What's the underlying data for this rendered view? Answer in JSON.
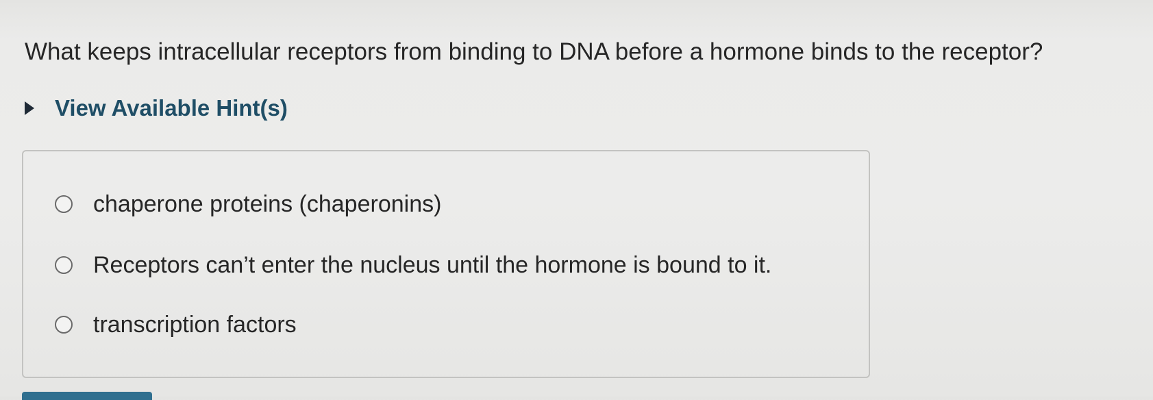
{
  "question": {
    "text": "What keeps intracellular receptors from binding to DNA before a hormone binds to the receptor?"
  },
  "hints": {
    "label": "View Available Hint(s)",
    "icon": "caret-right-icon"
  },
  "answer_options": [
    {
      "label": "chaperone proteins (chaperonins)",
      "selected": false
    },
    {
      "label": "Receptors can’t enter the nucleus until the hormone is bound to it.",
      "selected": false
    },
    {
      "label": "transcription factors",
      "selected": false
    }
  ],
  "colors": {
    "hint_text": "#1f4e66",
    "body_text": "#262626",
    "box_border": "#c3c3c1",
    "bottom_button": "#2f6f8f"
  }
}
